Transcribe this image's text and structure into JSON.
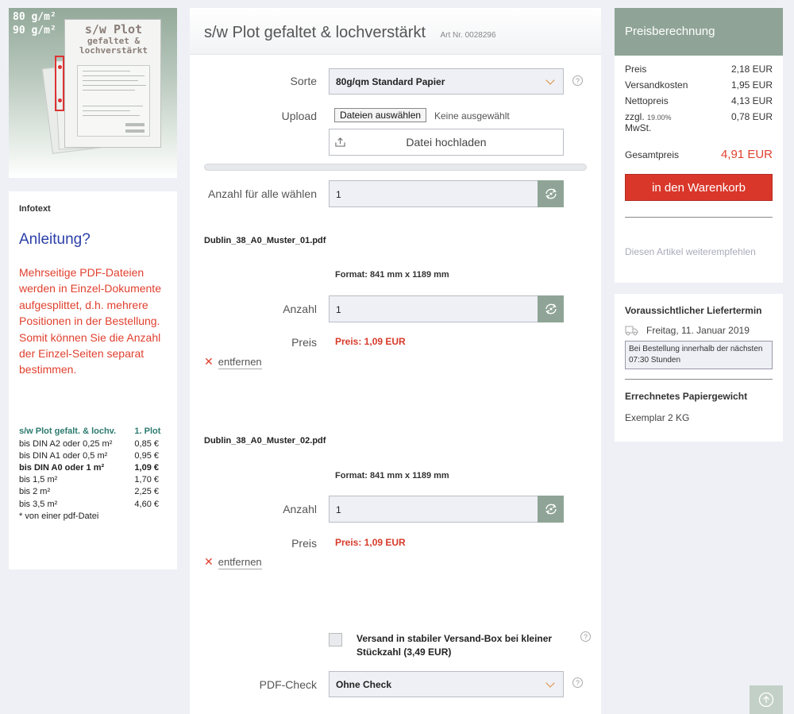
{
  "thumbnail": {
    "weight_line1": "80 g/m²",
    "weight_line2": "90 g/m²",
    "title_line1": "s/w Plot",
    "title_line2": "gefaltet &",
    "title_line3": "lochverstärkt"
  },
  "infotext": {
    "heading": "Infotext",
    "title": "Anleitung?",
    "body": "Mehrseitige PDF-Dateien werden in Einzel-Dokumente aufgesplittet, d.h. mehrere Positionen in der Bestellung. Somit können Sie die Anzahl der Einzel-Seiten separat bestimmen.",
    "table_header": [
      "s/w Plot gefalt. & lochv.",
      "1. Plot"
    ],
    "table_rows": [
      [
        "bis DIN A2 oder 0,25 m²",
        "0,85 €"
      ],
      [
        "bis DIN A1 oder 0,5 m²",
        "0,95 €"
      ],
      [
        "bis DIN A0 oder 1 m²",
        "1,09 €"
      ],
      [
        "bis 1,5 m²",
        "1,70 €"
      ],
      [
        "bis 2 m²",
        "2,25 €"
      ],
      [
        "bis 3,5 m²",
        "4,60 €"
      ]
    ],
    "note": "* von einer pdf-Datei"
  },
  "product": {
    "title": "s/w Plot gefaltet & lochverstärkt",
    "art_nr": "Art Nr. 0028296"
  },
  "form": {
    "sorte_label": "Sorte",
    "sorte_value": "80g/qm Standard Papier",
    "upload_label": "Upload",
    "file_button": "Dateien auswählen",
    "file_none": "Keine ausgewählt",
    "upload_button": "Datei hochladen",
    "anzahl_all_label": "Anzahl für alle wählen",
    "anzahl_all_value": "1",
    "help": "?"
  },
  "files": [
    {
      "name": "Dublin_38_A0_Muster_01.pdf",
      "format": "Format: 841 mm x 1189 mm",
      "anzahl_label": "Anzahl",
      "anzahl_value": "1",
      "preis_label": "Preis",
      "preis_value": "Preis: 1,09 EUR",
      "remove": "entfernen"
    },
    {
      "name": "Dublin_38_A0_Muster_02.pdf",
      "format": "Format: 841 mm x 1189 mm",
      "anzahl_label": "Anzahl",
      "anzahl_value": "1",
      "preis_label": "Preis",
      "preis_value": "Preis: 1,09 EUR",
      "remove": "entfernen"
    }
  ],
  "shipping": {
    "checkbox_label": "Versand in stabiler Versand-Box bei kleiner Stückzahl (3,49 EUR)"
  },
  "pdfcheck": {
    "label": "PDF-Check",
    "value": "Ohne Check"
  },
  "calc": {
    "heading": "Preisberechnung",
    "rows": [
      {
        "label": "Preis",
        "value": "2,18 EUR"
      },
      {
        "label": "Versandkosten",
        "value": "1,95 EUR"
      },
      {
        "label": "Nettopreis",
        "value": "4,13 EUR"
      }
    ],
    "vat_label1": "zzgl.",
    "vat_rate": "19.00%",
    "vat_label2": "MwSt.",
    "vat_value": "0,78 EUR",
    "total_label": "Gesamtpreis",
    "total_value": "4,91 EUR",
    "cart_button": "in den Warenkorb",
    "recommend": "Diesen Artikel weiterempfehlen"
  },
  "delivery": {
    "heading": "Voraussichtlicher Liefertermin",
    "date": "Freitag, 11. Januar 2019",
    "note": "Bei Bestellung innerhalb der nächsten 07:30 Stunden",
    "weight_heading": "Errechnetes Papiergewicht",
    "weight_value": "Exemplar 2 KG"
  },
  "colors": {
    "accent_green": "#8fa496",
    "red": "#d9372a",
    "blue": "#2b3fa8"
  }
}
